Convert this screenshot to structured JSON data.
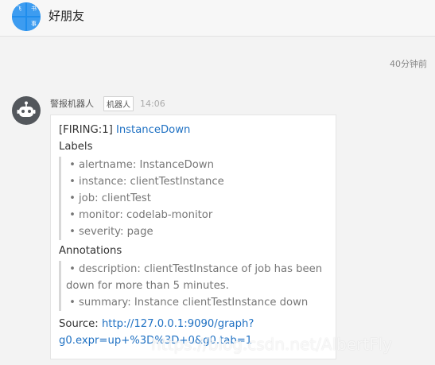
{
  "header": {
    "avatar_glyphs": [
      "飞",
      "书",
      "",
      "事"
    ],
    "title": "好朋友"
  },
  "divider": {
    "time": "40分钟前"
  },
  "message": {
    "sender": "警报机器人",
    "badge": "机器人",
    "time": "14:06",
    "firing_prefix": "[FIRING:1]",
    "firing_link": "InstanceDown",
    "labels_title": "Labels",
    "labels": [
      "alertname: InstanceDown",
      "instance: clientTestInstance",
      "job: clientTest",
      "monitor: codelab-monitor",
      "severity: page"
    ],
    "annotations_title": "Annotations",
    "annotation_desc_line1": "description: clientTestInstance of job has been",
    "annotation_desc_line2": "down for more than 5 minutes.",
    "annotation_summary": "summary: Instance clientTestInstance down",
    "source_label": "Source:",
    "source_link_line1": "http://127.0.0.1:9090/graph?",
    "source_link_line2": "g0.expr=up+%3D%3D+0&g0.tab=1"
  },
  "watermark": "https://blog.csdn.net/AlbertFly"
}
